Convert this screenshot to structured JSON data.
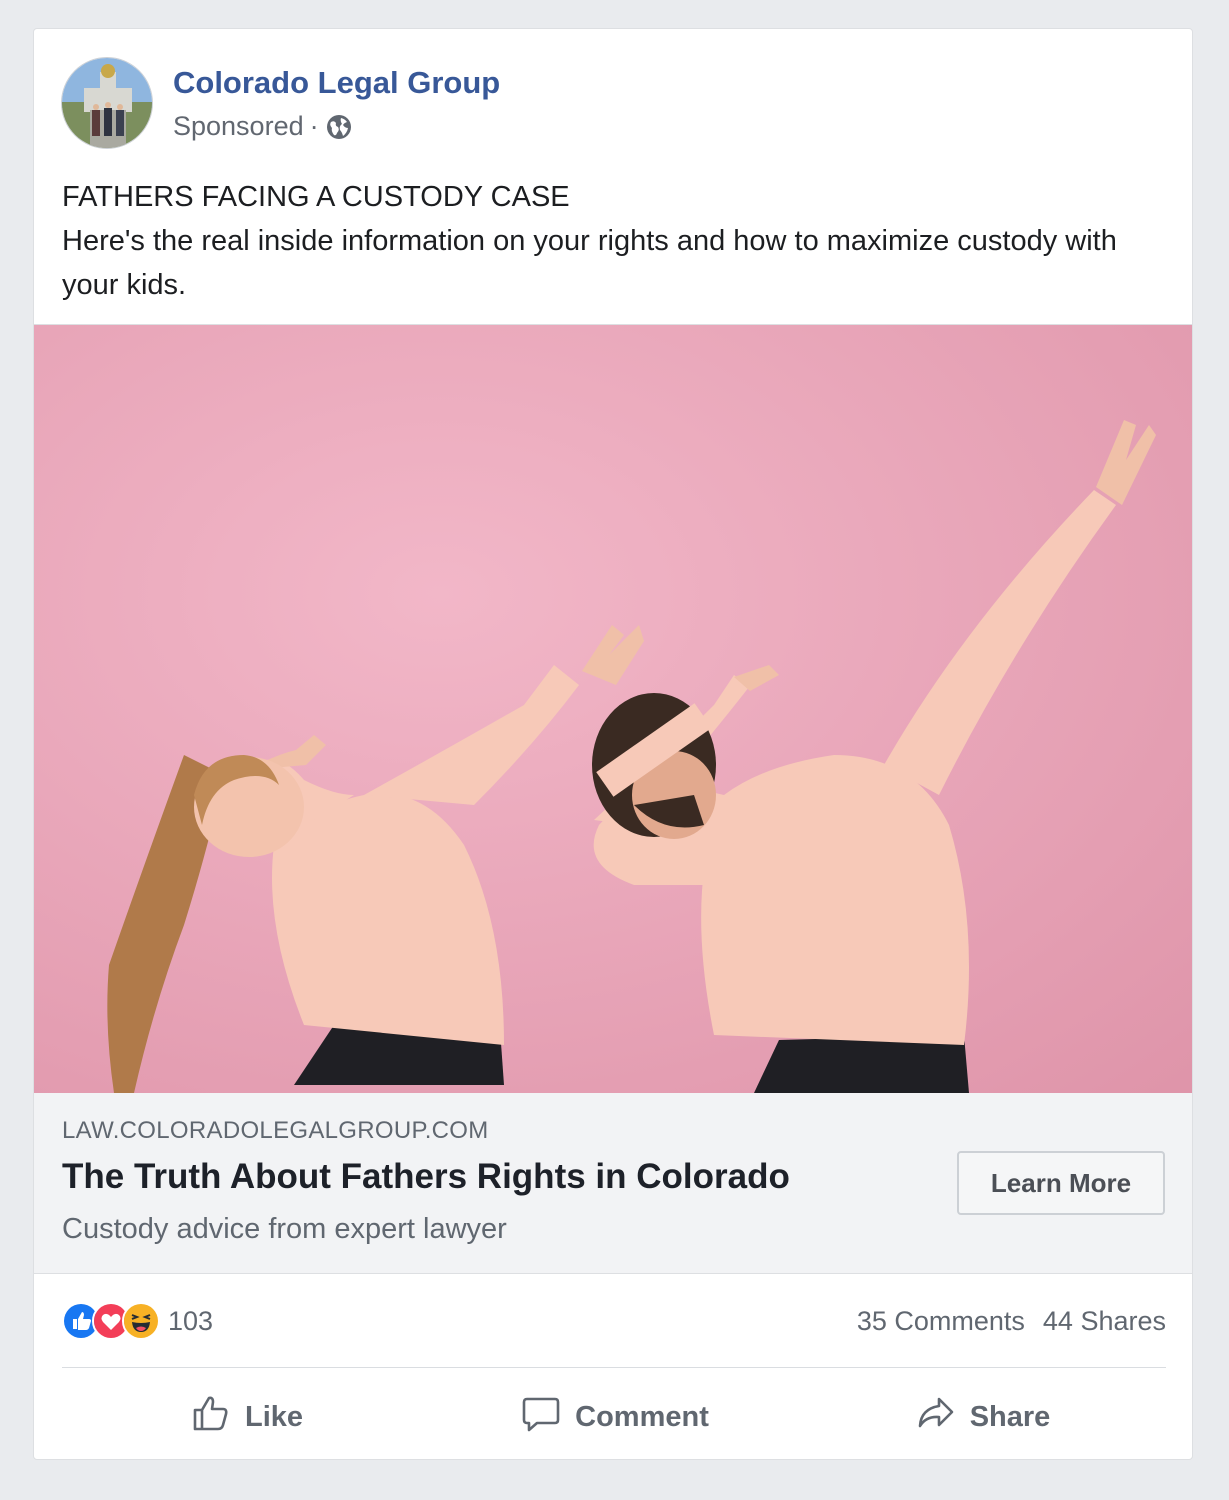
{
  "post": {
    "page_name": "Colorado Legal Group",
    "sponsored_label": "Sponsored",
    "separator": "·",
    "headline_text": "FATHERS FACING A CUSTODY CASE",
    "body_text": "Here's the real inside information on your rights and how to maximize custody with your kids."
  },
  "link_preview": {
    "domain": "LAW.COLORADOLEGALGROUP.COM",
    "title": "The Truth About Fathers Rights in Colorado",
    "description": "Custody advice from expert lawyer",
    "cta_label": "Learn More"
  },
  "engagement": {
    "reaction_icons": [
      "like-reaction-icon",
      "love-reaction-icon",
      "haha-reaction-icon"
    ],
    "reaction_count": "103",
    "comments": "35 Comments",
    "shares": "44 Shares"
  },
  "actions": {
    "like": "Like",
    "comment": "Comment",
    "share": "Share"
  },
  "colors": {
    "page_name": "#385898",
    "hero_background": "#e7a0b3",
    "like_blue": "#1877f2",
    "love_red": "#f33e58",
    "haha_yellow": "#f7b125"
  }
}
